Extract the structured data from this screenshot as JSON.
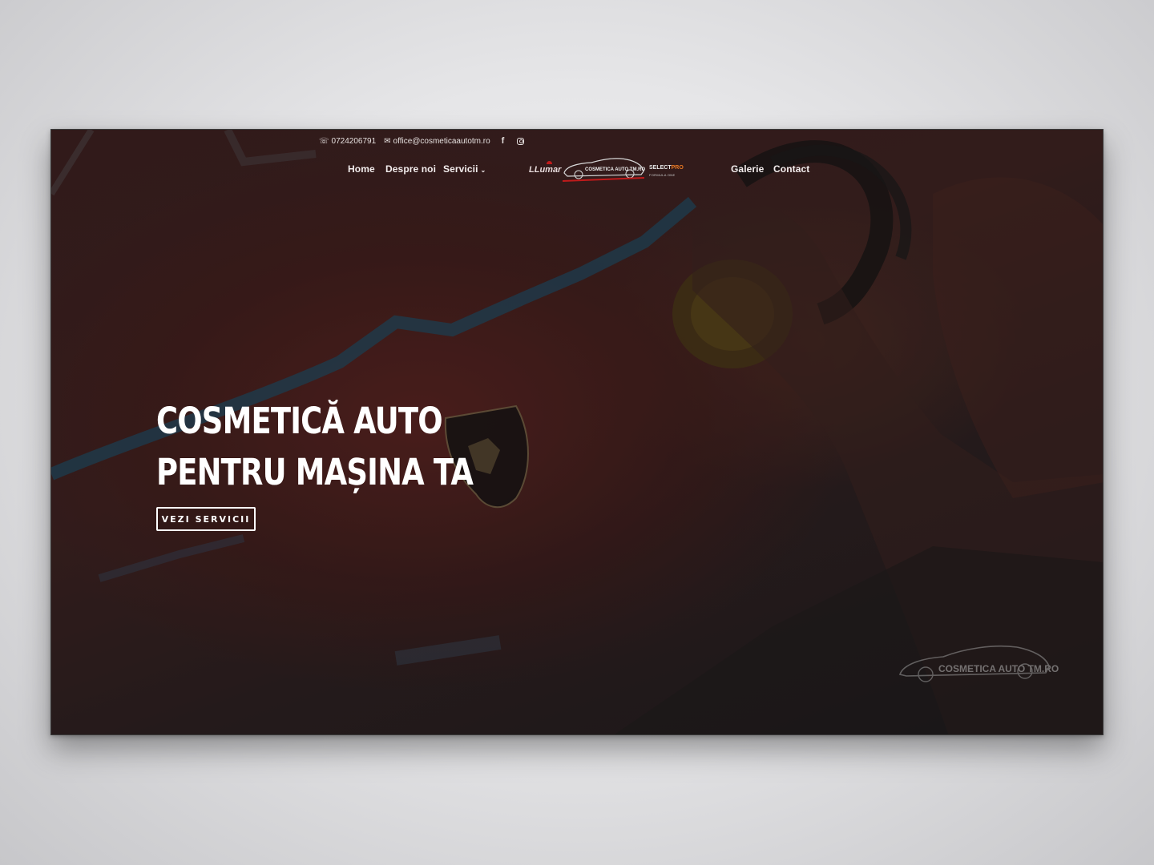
{
  "topbar": {
    "phone": "0724206791",
    "email": "office@cosmeticaautotm.ro",
    "icons": [
      "phone-icon",
      "envelope-icon",
      "facebook-icon",
      "instagram-icon"
    ],
    "facebook_glyph": "f"
  },
  "nav": {
    "items": [
      {
        "label": "Home"
      },
      {
        "label": "Despre noi"
      },
      {
        "label": "Servicii",
        "has_dropdown": true,
        "chevron": "⌄"
      },
      {
        "label": "Galerie"
      },
      {
        "label": "Contact"
      }
    ]
  },
  "logos": {
    "llumar": "LLumar",
    "main": "COSMETICA AUTO TM.RO",
    "select_a": "SELECT",
    "select_b": "PRO",
    "select_sub": "FORMULA ONE"
  },
  "hero": {
    "headline_line1": "COSMETICĂ AUTO",
    "headline_line2": "PENTRU MAȘINA TA",
    "cta_label": "VEZI SERVICII"
  },
  "watermark": {
    "text": "COSMETICA AUTO TM.RO"
  },
  "colors": {
    "accent_red": "#c01b1b",
    "select_orange": "#e87722",
    "text_white": "#ffffff"
  }
}
